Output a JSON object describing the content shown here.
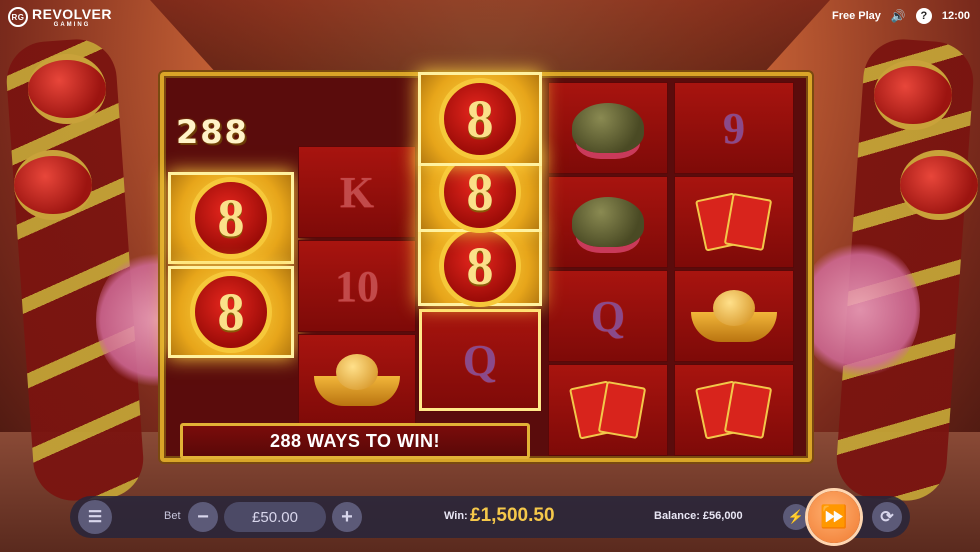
{
  "brand": {
    "name": "REVOLVER",
    "subtitle": "GAMING",
    "badge": "RG"
  },
  "topbar": {
    "mode": "Free Play",
    "time": "12:00",
    "help_label": "?"
  },
  "reels": {
    "ways_count": "288",
    "columns": [
      {
        "symbols": [
          "8",
          "8"
        ],
        "highlight": [
          true,
          true
        ]
      },
      {
        "symbols": [
          "K",
          "10",
          "ingot"
        ],
        "highlight": [
          false,
          false,
          false
        ]
      },
      {
        "symbols": [
          "8",
          "8",
          "8",
          "Q"
        ],
        "highlight": [
          true,
          true,
          true,
          false
        ]
      },
      {
        "symbols": [
          "toad",
          "toad",
          "Q",
          "envelopes"
        ],
        "highlight": [
          false,
          false,
          false,
          false
        ]
      },
      {
        "symbols": [
          "9",
          "envelopes",
          "ingot",
          "envelopes"
        ],
        "highlight": [
          false,
          false,
          false,
          false
        ]
      }
    ]
  },
  "banner": {
    "text": "288 WAYS TO WIN!"
  },
  "controls": {
    "menu_icon": "☰",
    "bet_label": "Bet",
    "bet_value": "£50.00",
    "minus": "−",
    "plus": "+",
    "win_label": "Win:",
    "win_value": "£1,500.50",
    "balance": "Balance: £56,000",
    "turbo_icon": "⚡",
    "spin_icon": "⏩",
    "autoplay_icon": "⟳"
  }
}
